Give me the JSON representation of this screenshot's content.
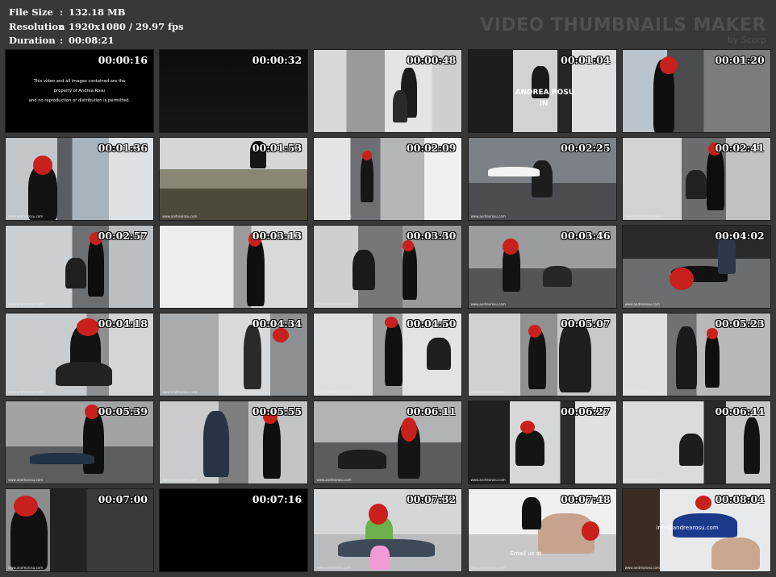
{
  "info": {
    "file_size_label": "File Size",
    "file_size_value": "132.18 MB",
    "resolution_label": "Resolution",
    "resolution_value": "1920x1080 / 29.97 fps",
    "duration_label": "Duration",
    "duration_value": "00:08:21"
  },
  "brand": {
    "title": "VIDEO THUMBNAILS MAKER",
    "subtitle": "by Scorp"
  },
  "notice": {
    "line1": "This video and all images contained are the",
    "line2": "property of Andrea Rosu",
    "line3": "and no reproduction or distribution is permitted."
  },
  "overlays": {
    "title_card_1": "ANDREA ROSU",
    "title_card_2": "IN",
    "email": "info@andrearosu.com",
    "email_us": "Email us at"
  },
  "watermark": "www.andrearosu.com",
  "thumbnails": [
    {
      "time": "00:00:16"
    },
    {
      "time": "00:00:32"
    },
    {
      "time": "00:00:48"
    },
    {
      "time": "00:01:04"
    },
    {
      "time": "00:01:20"
    },
    {
      "time": "00:01:36"
    },
    {
      "time": "00:01:53"
    },
    {
      "time": "00:02:09"
    },
    {
      "time": "00:02:25"
    },
    {
      "time": "00:02:41"
    },
    {
      "time": "00:02:57"
    },
    {
      "time": "00:03:13"
    },
    {
      "time": "00:03:30"
    },
    {
      "time": "00:03:46"
    },
    {
      "time": "00:04:02"
    },
    {
      "time": "00:04:18"
    },
    {
      "time": "00:04:34"
    },
    {
      "time": "00:04:50"
    },
    {
      "time": "00:05:07"
    },
    {
      "time": "00:05:23"
    },
    {
      "time": "00:05:39"
    },
    {
      "time": "00:05:55"
    },
    {
      "time": "00:06:11"
    },
    {
      "time": "00:06:27"
    },
    {
      "time": "00:06:44"
    },
    {
      "time": "00:07:00"
    },
    {
      "time": "00:07:16"
    },
    {
      "time": "00:07:32"
    },
    {
      "time": "00:07:48"
    },
    {
      "time": "00:08:04"
    }
  ]
}
